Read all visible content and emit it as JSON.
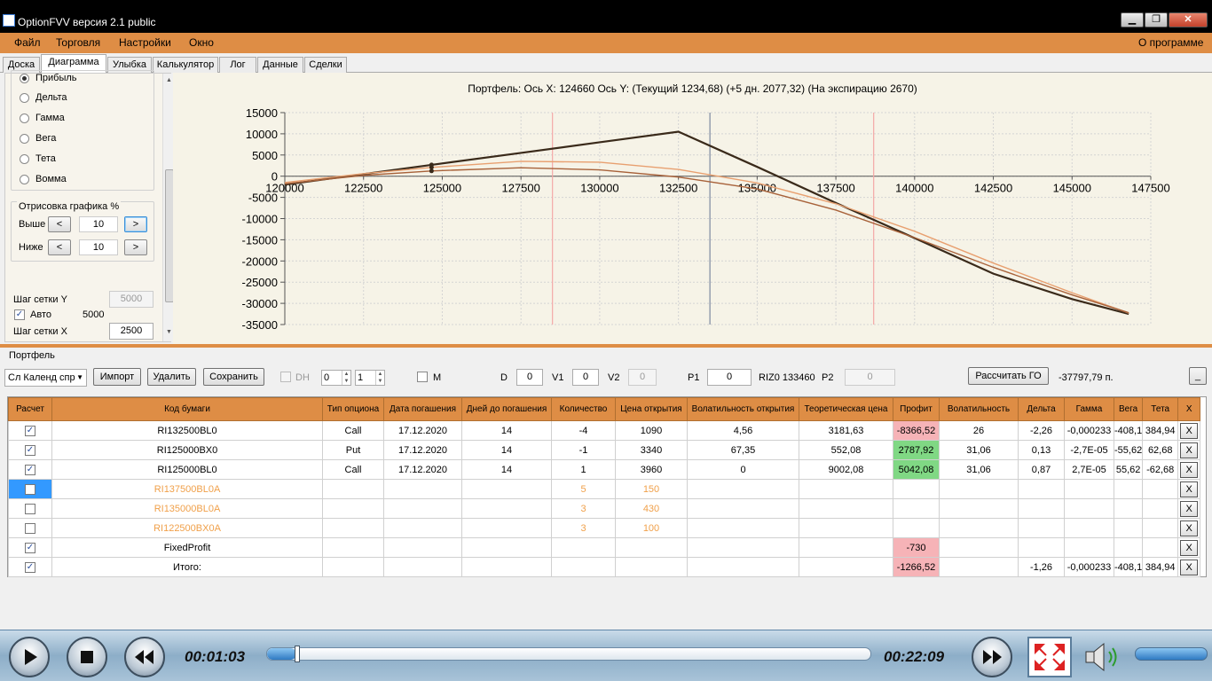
{
  "window": {
    "title": "OptionFVV версия 2.1 public",
    "minimize": "▁",
    "maximize": "❐",
    "close": "✕"
  },
  "menu": {
    "items": [
      "Файл",
      "Торговля",
      "Настройки",
      "Окно"
    ],
    "about": "О программе"
  },
  "tabs": [
    "Доска",
    "Диаграмма",
    "Улыбка",
    "Калькулятор",
    "Лог",
    "Данные",
    "Сделки"
  ],
  "left_panel": {
    "modes": [
      {
        "label": "Прибыль",
        "selected": true
      },
      {
        "label": "Дельта",
        "selected": false
      },
      {
        "label": "Гамма",
        "selected": false
      },
      {
        "label": "Вега",
        "selected": false
      },
      {
        "label": "Тета",
        "selected": false
      },
      {
        "label": "Вомма",
        "selected": false
      }
    ],
    "render_group": "Отрисовка графика %",
    "above_label": "Выше",
    "above_value": "10",
    "below_label": "Ниже",
    "below_value": "10",
    "btn_dec": "<",
    "btn_inc": ">",
    "grid_y_label": "Шаг сетки Y",
    "grid_y_value": "5000",
    "auto_label": "Авто",
    "auto_value": "5000",
    "auto_checked": true,
    "grid_x_label": "Шаг сетки X",
    "grid_x_value": "2500"
  },
  "chart_data": {
    "type": "line",
    "title": "Портфель: Ось X: 124660 Ось Y:  (Текущий 1234,68)  (+5 дн. 2077,32)  (На экспирацию 2670)",
    "xlim": [
      120000,
      147500
    ],
    "ylim": [
      -35000,
      15000
    ],
    "x_ticks": [
      120000,
      122500,
      125000,
      127500,
      130000,
      132500,
      135000,
      137500,
      140000,
      142500,
      145000,
      147500
    ],
    "y_ticks": [
      15000,
      10000,
      5000,
      0,
      -5000,
      -10000,
      -15000,
      -20000,
      -25000,
      -30000,
      -35000
    ],
    "grid": true,
    "vertical_markers": [
      {
        "x": 128500,
        "color": "#f4a8a8"
      },
      {
        "x": 133500,
        "color": "#7d8aa0"
      },
      {
        "x": 138700,
        "color": "#f4a8a8"
      }
    ],
    "cursor_x": 124660,
    "series": [
      {
        "color": "#3a2a1a",
        "x": [
          120000,
          122500,
          124660,
          127500,
          130000,
          132500,
          135000,
          137500,
          140000,
          142500,
          145000,
          146800
        ],
        "y": [
          -2000,
          500,
          2670,
          5500,
          8000,
          10500,
          2200,
          -6300,
          -14600,
          -23000,
          -29000,
          -32500
        ]
      },
      {
        "color": "#e8a070",
        "x": [
          120000,
          122500,
          124660,
          127500,
          130000,
          132500,
          135000,
          137500,
          140000,
          142500,
          145000,
          146800
        ],
        "y": [
          -1500,
          600,
          2077,
          3500,
          3300,
          1600,
          -1600,
          -6500,
          -13000,
          -20500,
          -27500,
          -32300
        ]
      },
      {
        "color": "#a8623a",
        "x": [
          120000,
          122500,
          124660,
          127500,
          130000,
          132500,
          135000,
          137500,
          140000,
          142500,
          145000,
          146800
        ],
        "y": [
          -1800,
          200,
          1235,
          2000,
          1500,
          -200,
          -3000,
          -8000,
          -14500,
          -21500,
          -28000,
          -32200
        ]
      }
    ]
  },
  "portfolio": {
    "section_label": "Портфель",
    "combo_value": "Сл Календ спр",
    "import": "Импорт",
    "delete": "Удалить",
    "save": "Сохранить",
    "dh_label": "DH",
    "spin1": "0",
    "spin2": "1",
    "m_label": "M",
    "d_label": "D",
    "d_value": "0",
    "v1_label": "V1",
    "v1_value": "0",
    "v2_label": "V2",
    "v2_value": "0",
    "p1_label": "P1",
    "p1_value": "0",
    "instrument": "RIZ0 133460",
    "p2_label": "P2",
    "p2_value": "0",
    "calc_go": "Рассчитать ГО",
    "go_value": "-37797,79 п.",
    "min_btn": "_"
  },
  "table": {
    "headers": [
      "Расчет",
      "Код бумаги",
      "Тип опциона",
      "Дата погашения",
      "Дней до погашения",
      "Количество",
      "Цена открытия",
      "Волатильность открытия",
      "Теоретическая цена",
      "Профит",
      "Волатильность",
      "Дельта",
      "Гамма",
      "Вега",
      "Тета",
      "X"
    ],
    "rows": [
      {
        "checked": true,
        "cells": [
          "RI132500BL0",
          "Call",
          "17.12.2020",
          "14",
          "-4",
          "1090",
          "4,56",
          "3181,63",
          "-8366,52",
          "26",
          "-2,26",
          "-0,000233",
          "-408,1",
          "384,94"
        ],
        "profit_state": "neg",
        "dim": false,
        "sel": false
      },
      {
        "checked": true,
        "cells": [
          "RI125000BX0",
          "Put",
          "17.12.2020",
          "14",
          "-1",
          "3340",
          "67,35",
          "552,08",
          "2787,92",
          "31,06",
          "0,13",
          "-2,7E-05",
          "-55,62",
          "62,68"
        ],
        "profit_state": "pos",
        "dim": false,
        "sel": false
      },
      {
        "checked": true,
        "cells": [
          "RI125000BL0",
          "Call",
          "17.12.2020",
          "14",
          "1",
          "3960",
          "0",
          "9002,08",
          "5042,08",
          "31,06",
          "0,87",
          "2,7E-05",
          "55,62",
          "-62,68"
        ],
        "profit_state": "pos",
        "dim": false,
        "sel": false
      },
      {
        "checked": false,
        "cells": [
          "RI137500BL0A",
          "",
          "",
          "",
          "5",
          "150",
          "",
          "",
          "",
          "",
          "",
          "",
          "",
          ""
        ],
        "profit_state": "",
        "dim": true,
        "sel": true
      },
      {
        "checked": false,
        "cells": [
          "RI135000BL0A",
          "",
          "",
          "",
          "3",
          "430",
          "",
          "",
          "",
          "",
          "",
          "",
          "",
          ""
        ],
        "profit_state": "",
        "dim": true,
        "sel": false
      },
      {
        "checked": false,
        "cells": [
          "RI122500BX0A",
          "",
          "",
          "",
          "3",
          "100",
          "",
          "",
          "",
          "",
          "",
          "",
          "",
          ""
        ],
        "profit_state": "",
        "dim": true,
        "sel": false
      },
      {
        "checked": true,
        "cells": [
          "FixedProfit",
          "",
          "",
          "",
          "",
          "",
          "",
          "",
          "-730",
          "",
          "",
          "",
          "",
          ""
        ],
        "profit_state": "neg",
        "dim": false,
        "sel": false
      },
      {
        "checked": true,
        "cells": [
          "Итого:",
          "",
          "",
          "",
          "",
          "",
          "",
          "",
          "-1266,52",
          "",
          "-1,26",
          "-0,000233",
          "-408,1",
          "384,94"
        ],
        "profit_state": "neg",
        "dim": false,
        "sel": false
      }
    ],
    "delete_label": "X"
  },
  "player": {
    "elapsed": "00:01:03",
    "total": "00:22:09",
    "progress": 0.048,
    "volume": 1.0
  }
}
